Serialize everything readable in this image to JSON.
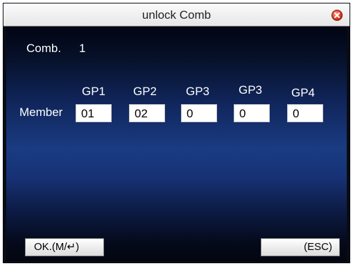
{
  "window": {
    "title": "unlock Comb"
  },
  "comb": {
    "label": "Comb.",
    "value": "1"
  },
  "member_label": "Member",
  "groups": [
    {
      "header": "GP1",
      "value": "01"
    },
    {
      "header": "GP2",
      "value": "02"
    },
    {
      "header": "GP3",
      "value": "0"
    },
    {
      "header": "GP3",
      "value": "0"
    },
    {
      "header": "GP4",
      "value": "0"
    }
  ],
  "buttons": {
    "ok_label": "OK.(M/↵)",
    "esc_label": "(ESC)"
  }
}
